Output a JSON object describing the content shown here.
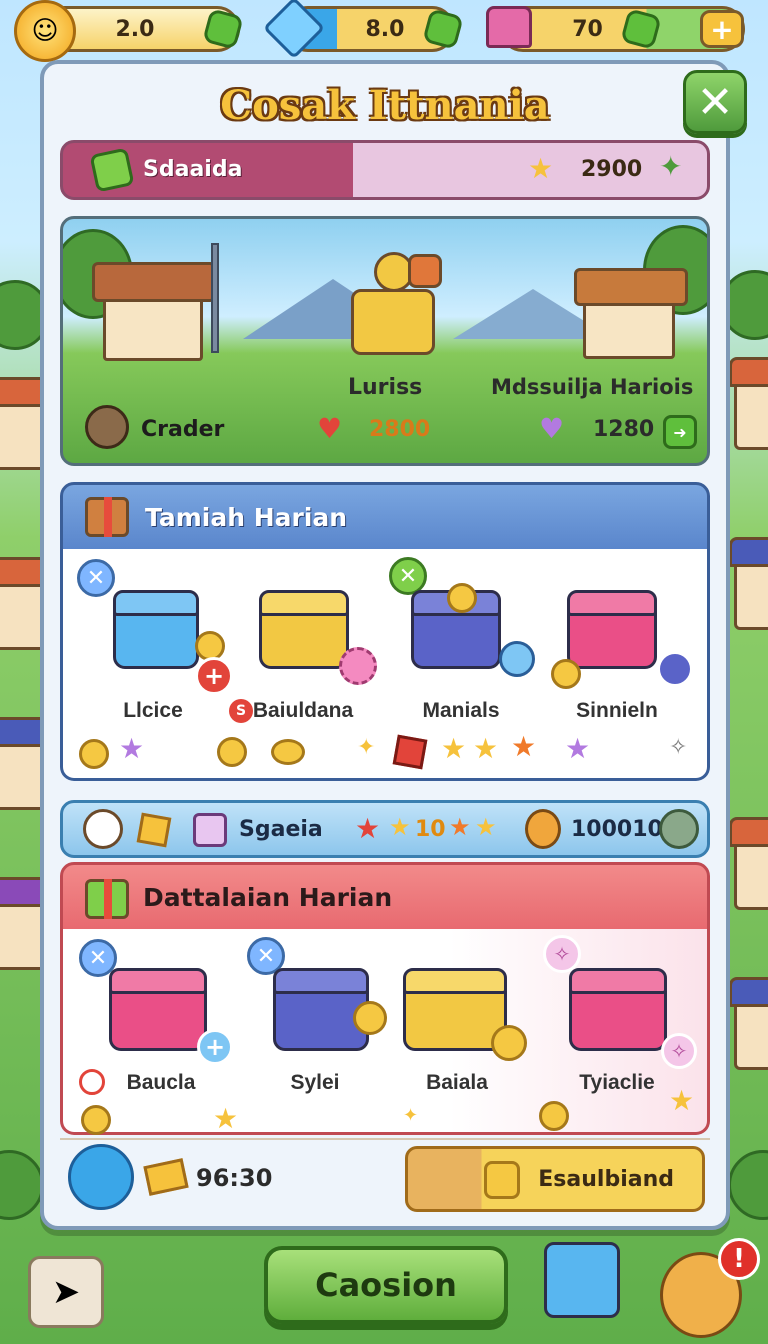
{
  "hud": {
    "sun_value": "2.0",
    "diamond_value": "8.0",
    "house_value": "70",
    "plus_label": "+"
  },
  "panel": {
    "title": "Cosak Ittnania",
    "close_label": "✕"
  },
  "resource_bar": {
    "name": "Sdaaida",
    "star_value": "2900"
  },
  "scene": {
    "chest_label": "Luriss",
    "right_label": "Mdssuilja Hariois",
    "character_name": "Crader",
    "heart_value": "2800",
    "purple_heart_value": "1280"
  },
  "daily_tasks": {
    "header": "Tamiah Harian",
    "items": [
      {
        "label": "Llcice",
        "color": "#58b6f0"
      },
      {
        "label": "Baiuldana",
        "color": "#f2c843"
      },
      {
        "label": "Manials",
        "color": "#5a63c8"
      },
      {
        "label": "Sinnieln",
        "color": "#ea4f87"
      }
    ],
    "badge_s": "S"
  },
  "strip": {
    "name": "Sgaeia",
    "stars_value": "10",
    "score": "100010"
  },
  "daily_list": {
    "header": "Dattalaian Harian",
    "items": [
      {
        "label": "Baucla",
        "color": "#ea4f87"
      },
      {
        "label": "Sylei",
        "color": "#5a63c8"
      },
      {
        "label": "Baiala",
        "color": "#f2c843"
      },
      {
        "label": "Tyiaclie",
        "color": "#ea4f87"
      }
    ]
  },
  "footer": {
    "timer": "96:30",
    "exchange_label": "Esaulbiand"
  },
  "bottom": {
    "main_button": "Caosion",
    "alert": "!"
  }
}
